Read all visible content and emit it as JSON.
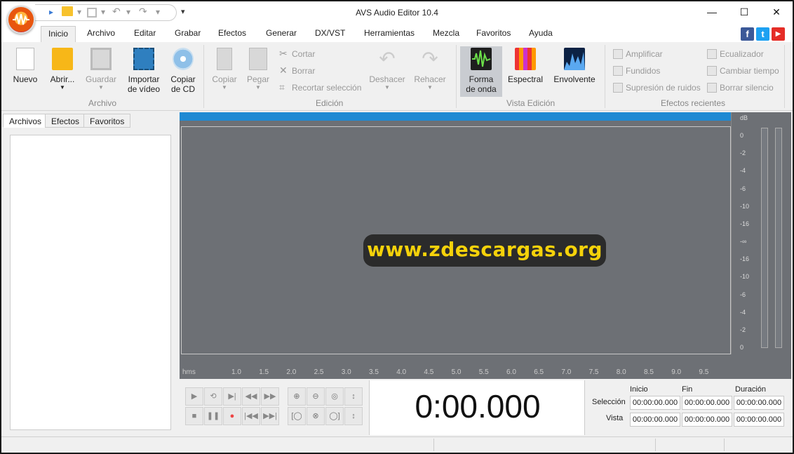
{
  "window": {
    "title": "AVS Audio Editor 10.4",
    "minimize": "—",
    "maximize": "☐",
    "close": "✕"
  },
  "quick_access": {
    "new": "▸",
    "open": "▾",
    "save": "▾",
    "undo": "▾",
    "redo": "▾",
    "customize": "▾"
  },
  "menu": {
    "tabs": [
      "Inicio",
      "Archivo",
      "Editar",
      "Grabar",
      "Efectos",
      "Generar",
      "DX/VST",
      "Herramientas",
      "Mezcla",
      "Favoritos",
      "Ayuda"
    ],
    "active": "Inicio"
  },
  "social": {
    "facebook": "f",
    "twitter": "t",
    "youtube": "▶"
  },
  "ribbon": {
    "archivo": {
      "label": "Archivo",
      "nuevo": "Nuevo",
      "abrir": "Abrir...",
      "guardar": "Guardar",
      "importar_line1": "Importar",
      "importar_line2": "de vídeo",
      "copiar_line1": "Copiar",
      "copiar_line2": "de CD"
    },
    "edicion": {
      "label": "Edición",
      "copiar": "Copiar",
      "pegar": "Pegar",
      "cortar": "Cortar",
      "borrar": "Borrar",
      "recortar": "Recortar selección",
      "deshacer": "Deshacer",
      "rehacer": "Rehacer"
    },
    "vista": {
      "label": "Vista Edición",
      "forma_line1": "Forma",
      "forma_line2": "de onda",
      "espectral": "Espectral",
      "envolvente": "Envolvente"
    },
    "recientes": {
      "label": "Efectos recientes",
      "amplificar": "Amplificar",
      "fundidos": "Fundidos",
      "supresion": "Supresión de ruidos",
      "ecualizador": "Ecualizador",
      "cambiar": "Cambiar tiempo",
      "borrar_silencio": "Borrar silencio"
    }
  },
  "left_panel": {
    "tabs": [
      "Archivos",
      "Efectos",
      "Favoritos"
    ]
  },
  "db_scale": {
    "unit": "dB",
    "labels": [
      "0",
      "-2",
      "-4",
      "-6",
      "-10",
      "-16",
      "-∞",
      "-16",
      "-10",
      "-6",
      "-4",
      "-2",
      "0"
    ]
  },
  "ruler": {
    "unit": "hms",
    "labels": [
      "1.0",
      "1.5",
      "2.0",
      "2.5",
      "3.0",
      "3.5",
      "4.0",
      "4.5",
      "5.0",
      "5.5",
      "6.0",
      "6.5",
      "7.0",
      "7.5",
      "8.0",
      "8.5",
      "9.0",
      "9.5"
    ]
  },
  "watermark": "www.zdescargas.org",
  "time_display": "0:00.000",
  "selection": {
    "col_inicio": "Inicio",
    "col_fin": "Fin",
    "col_duracion": "Duración",
    "row_seleccion": "Selección",
    "row_vista": "Vista",
    "sel_inicio": "00:00:00.000",
    "sel_fin": "00:00:00.000",
    "sel_duracion": "00:00:00.000",
    "vista_inicio": "00:00:00.000",
    "vista_fin": "00:00:00.000",
    "vista_duracion": "00:00:00.000"
  },
  "colors": {
    "accent": "#1f8ad3",
    "wave_bg": "#6d7075",
    "watermark": "#f5d20a"
  }
}
